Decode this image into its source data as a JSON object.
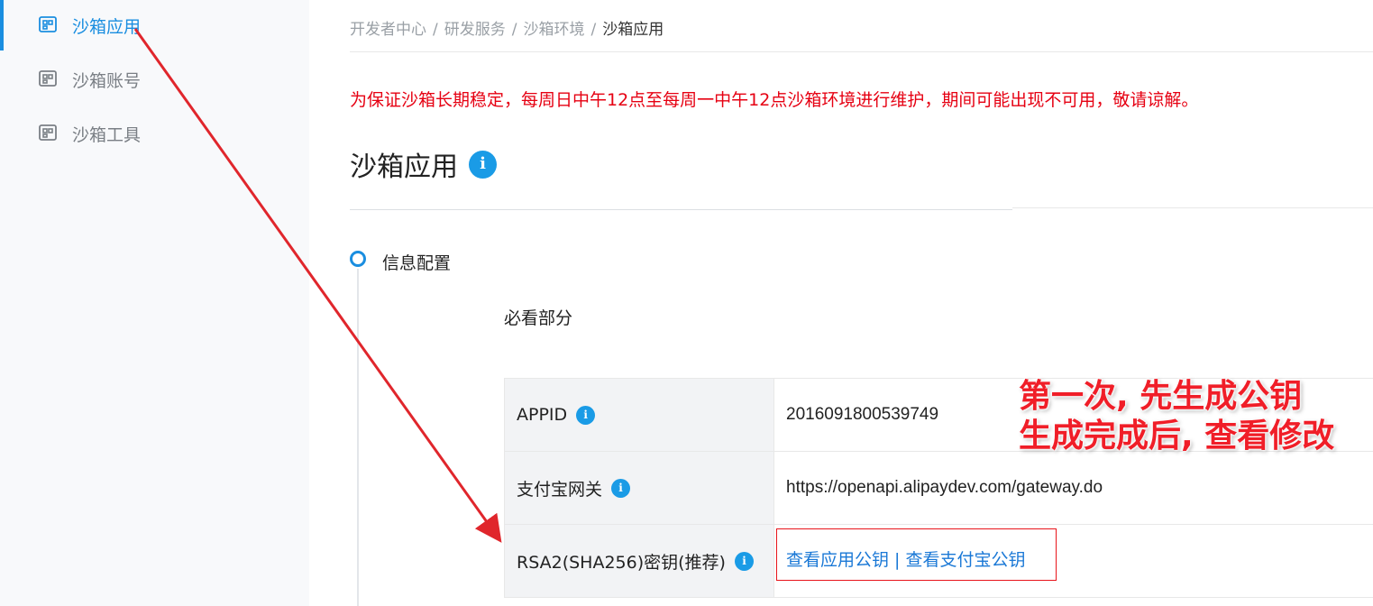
{
  "sidebar": {
    "items": [
      {
        "label": "沙箱应用",
        "icon": "app-grid-icon",
        "active": true
      },
      {
        "label": "沙箱账号",
        "icon": "app-grid-icon",
        "active": false
      },
      {
        "label": "沙箱工具",
        "icon": "app-grid-icon",
        "active": false
      }
    ]
  },
  "breadcrumb": {
    "items": [
      "开发者中心",
      "研发服务",
      "沙箱环境",
      "沙箱应用"
    ],
    "separator": "/"
  },
  "notice": "为保证沙箱长期稳定，每周日中午12点至每周一中午12点沙箱环境进行维护，期间可能出现不可用，敬请谅解。",
  "page": {
    "title": "沙箱应用",
    "info_glyph": "i"
  },
  "step": {
    "label": "信息配置",
    "section": "必看部分"
  },
  "config_table": {
    "rows": [
      {
        "key": "APPID",
        "value": "2016091800539749"
      },
      {
        "key": "支付宝网关",
        "value": "https://openapi.alipaydev.com/gateway.do"
      },
      {
        "key": "RSA2(SHA256)密钥(推荐)",
        "value": ""
      }
    ],
    "key_links": {
      "app_key": "查看应用公钥",
      "separator": " | ",
      "alipay_key": "查看支付宝公钥"
    }
  },
  "annotation": {
    "line1": "第一次, 先生成公钥",
    "line2": "生成完成后, 查看修改"
  },
  "colors": {
    "accent": "#1a8ee0",
    "notice": "#e60012",
    "annotation": "#f01e28",
    "link": "#1a78d6"
  }
}
